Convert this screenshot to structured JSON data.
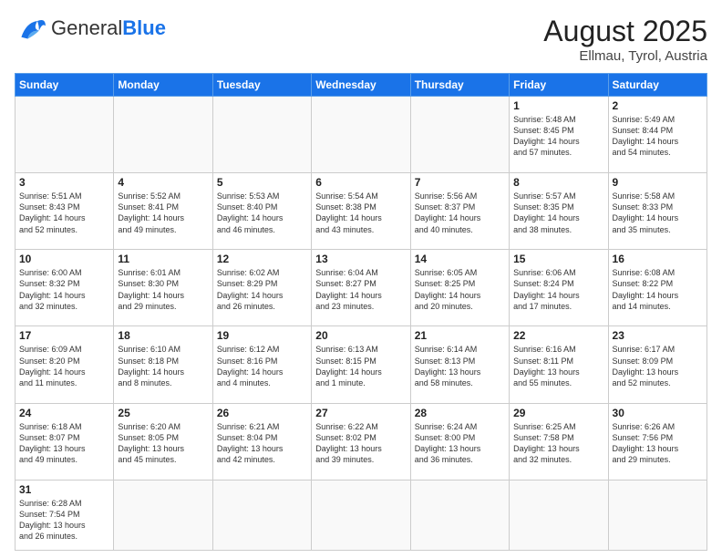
{
  "header": {
    "logo_general": "General",
    "logo_blue": "Blue",
    "title": "August 2025",
    "subtitle": "Ellmau, Tyrol, Austria"
  },
  "weekdays": [
    "Sunday",
    "Monday",
    "Tuesday",
    "Wednesday",
    "Thursday",
    "Friday",
    "Saturday"
  ],
  "weeks": [
    [
      {
        "day": "",
        "info": ""
      },
      {
        "day": "",
        "info": ""
      },
      {
        "day": "",
        "info": ""
      },
      {
        "day": "",
        "info": ""
      },
      {
        "day": "",
        "info": ""
      },
      {
        "day": "1",
        "info": "Sunrise: 5:48 AM\nSunset: 8:45 PM\nDaylight: 14 hours\nand 57 minutes."
      },
      {
        "day": "2",
        "info": "Sunrise: 5:49 AM\nSunset: 8:44 PM\nDaylight: 14 hours\nand 54 minutes."
      }
    ],
    [
      {
        "day": "3",
        "info": "Sunrise: 5:51 AM\nSunset: 8:43 PM\nDaylight: 14 hours\nand 52 minutes."
      },
      {
        "day": "4",
        "info": "Sunrise: 5:52 AM\nSunset: 8:41 PM\nDaylight: 14 hours\nand 49 minutes."
      },
      {
        "day": "5",
        "info": "Sunrise: 5:53 AM\nSunset: 8:40 PM\nDaylight: 14 hours\nand 46 minutes."
      },
      {
        "day": "6",
        "info": "Sunrise: 5:54 AM\nSunset: 8:38 PM\nDaylight: 14 hours\nand 43 minutes."
      },
      {
        "day": "7",
        "info": "Sunrise: 5:56 AM\nSunset: 8:37 PM\nDaylight: 14 hours\nand 40 minutes."
      },
      {
        "day": "8",
        "info": "Sunrise: 5:57 AM\nSunset: 8:35 PM\nDaylight: 14 hours\nand 38 minutes."
      },
      {
        "day": "9",
        "info": "Sunrise: 5:58 AM\nSunset: 8:33 PM\nDaylight: 14 hours\nand 35 minutes."
      }
    ],
    [
      {
        "day": "10",
        "info": "Sunrise: 6:00 AM\nSunset: 8:32 PM\nDaylight: 14 hours\nand 32 minutes."
      },
      {
        "day": "11",
        "info": "Sunrise: 6:01 AM\nSunset: 8:30 PM\nDaylight: 14 hours\nand 29 minutes."
      },
      {
        "day": "12",
        "info": "Sunrise: 6:02 AM\nSunset: 8:29 PM\nDaylight: 14 hours\nand 26 minutes."
      },
      {
        "day": "13",
        "info": "Sunrise: 6:04 AM\nSunset: 8:27 PM\nDaylight: 14 hours\nand 23 minutes."
      },
      {
        "day": "14",
        "info": "Sunrise: 6:05 AM\nSunset: 8:25 PM\nDaylight: 14 hours\nand 20 minutes."
      },
      {
        "day": "15",
        "info": "Sunrise: 6:06 AM\nSunset: 8:24 PM\nDaylight: 14 hours\nand 17 minutes."
      },
      {
        "day": "16",
        "info": "Sunrise: 6:08 AM\nSunset: 8:22 PM\nDaylight: 14 hours\nand 14 minutes."
      }
    ],
    [
      {
        "day": "17",
        "info": "Sunrise: 6:09 AM\nSunset: 8:20 PM\nDaylight: 14 hours\nand 11 minutes."
      },
      {
        "day": "18",
        "info": "Sunrise: 6:10 AM\nSunset: 8:18 PM\nDaylight: 14 hours\nand 8 minutes."
      },
      {
        "day": "19",
        "info": "Sunrise: 6:12 AM\nSunset: 8:16 PM\nDaylight: 14 hours\nand 4 minutes."
      },
      {
        "day": "20",
        "info": "Sunrise: 6:13 AM\nSunset: 8:15 PM\nDaylight: 14 hours\nand 1 minute."
      },
      {
        "day": "21",
        "info": "Sunrise: 6:14 AM\nSunset: 8:13 PM\nDaylight: 13 hours\nand 58 minutes."
      },
      {
        "day": "22",
        "info": "Sunrise: 6:16 AM\nSunset: 8:11 PM\nDaylight: 13 hours\nand 55 minutes."
      },
      {
        "day": "23",
        "info": "Sunrise: 6:17 AM\nSunset: 8:09 PM\nDaylight: 13 hours\nand 52 minutes."
      }
    ],
    [
      {
        "day": "24",
        "info": "Sunrise: 6:18 AM\nSunset: 8:07 PM\nDaylight: 13 hours\nand 49 minutes."
      },
      {
        "day": "25",
        "info": "Sunrise: 6:20 AM\nSunset: 8:05 PM\nDaylight: 13 hours\nand 45 minutes."
      },
      {
        "day": "26",
        "info": "Sunrise: 6:21 AM\nSunset: 8:04 PM\nDaylight: 13 hours\nand 42 minutes."
      },
      {
        "day": "27",
        "info": "Sunrise: 6:22 AM\nSunset: 8:02 PM\nDaylight: 13 hours\nand 39 minutes."
      },
      {
        "day": "28",
        "info": "Sunrise: 6:24 AM\nSunset: 8:00 PM\nDaylight: 13 hours\nand 36 minutes."
      },
      {
        "day": "29",
        "info": "Sunrise: 6:25 AM\nSunset: 7:58 PM\nDaylight: 13 hours\nand 32 minutes."
      },
      {
        "day": "30",
        "info": "Sunrise: 6:26 AM\nSunset: 7:56 PM\nDaylight: 13 hours\nand 29 minutes."
      }
    ],
    [
      {
        "day": "31",
        "info": "Sunrise: 6:28 AM\nSunset: 7:54 PM\nDaylight: 13 hours\nand 26 minutes."
      },
      {
        "day": "",
        "info": ""
      },
      {
        "day": "",
        "info": ""
      },
      {
        "day": "",
        "info": ""
      },
      {
        "day": "",
        "info": ""
      },
      {
        "day": "",
        "info": ""
      },
      {
        "day": "",
        "info": ""
      }
    ]
  ]
}
